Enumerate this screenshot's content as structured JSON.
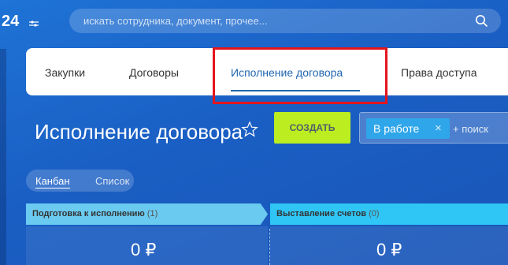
{
  "header": {
    "logo_number": "24",
    "search": {
      "placeholder": "искать сотрудника, документ, прочее..."
    }
  },
  "tabs": [
    {
      "label": "Закупки"
    },
    {
      "label": "Договоры"
    },
    {
      "label": "Исполнение договора",
      "active": true
    },
    {
      "label": "Права доступа"
    }
  ],
  "page": {
    "title": "Исполнение договора",
    "create_label": "СОЗДАТЬ",
    "filter": {
      "chip_label": "В работе",
      "chip_remove": "×",
      "add_label": "+ поиск"
    }
  },
  "view_switch": {
    "options": [
      "Канбан",
      "Список"
    ],
    "active": "Канбан"
  },
  "kanban": {
    "columns": [
      {
        "title": "Подготовка к исполнению",
        "count": "(1)",
        "sum": "0 ₽"
      },
      {
        "title": "Выставление счетов",
        "count": "(0)",
        "sum": "0 ₽"
      }
    ]
  },
  "colors": {
    "accent": "#2066b0",
    "highlight": "#e3151c",
    "create_button": "#bbed21",
    "filter_chip": "#2fa6ea",
    "column1": "#6bcaf0",
    "column2": "#2fc6f6"
  }
}
